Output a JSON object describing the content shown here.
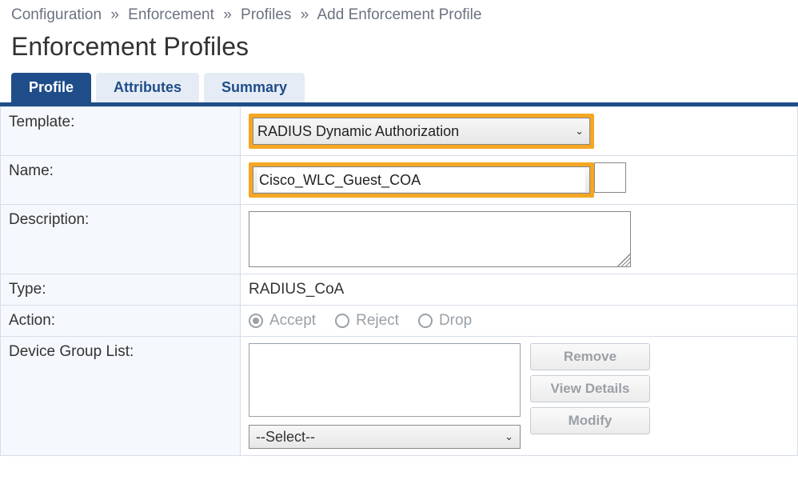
{
  "breadcrumb": {
    "items": [
      "Configuration",
      "Enforcement",
      "Profiles",
      "Add Enforcement Profile"
    ]
  },
  "page": {
    "title": "Enforcement Profiles"
  },
  "tabs": {
    "profile": "Profile",
    "attributes": "Attributes",
    "summary": "Summary"
  },
  "form": {
    "template": {
      "label": "Template:",
      "value": "RADIUS Dynamic Authorization"
    },
    "name": {
      "label": "Name:",
      "value": "Cisco_WLC_Guest_COA"
    },
    "description": {
      "label": "Description:",
      "value": ""
    },
    "type": {
      "label": "Type:",
      "value": "RADIUS_CoA"
    },
    "action": {
      "label": "Action:",
      "options": {
        "accept": "Accept",
        "reject": "Reject",
        "drop": "Drop"
      },
      "selected": "accept"
    },
    "device_group_list": {
      "label": "Device Group List:",
      "select_placeholder": "--Select--",
      "buttons": {
        "remove": "Remove",
        "view": "View Details",
        "modify": "Modify"
      }
    }
  }
}
